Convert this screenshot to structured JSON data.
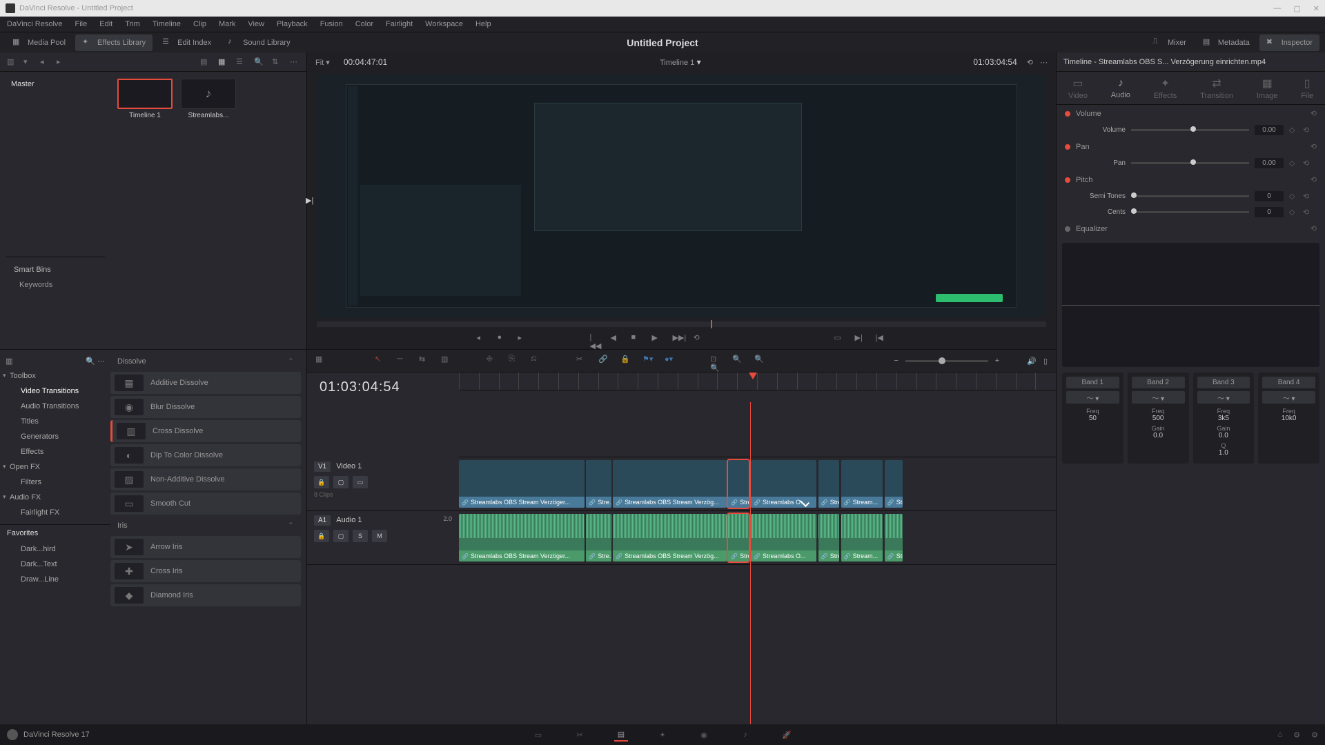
{
  "titlebar": {
    "text": "DaVinci Resolve - Untitled Project"
  },
  "menu": [
    "DaVinci Resolve",
    "File",
    "Edit",
    "Trim",
    "Timeline",
    "Clip",
    "Mark",
    "View",
    "Playback",
    "Fusion",
    "Color",
    "Fairlight",
    "Workspace",
    "Help"
  ],
  "shelf": {
    "media_pool": "Media Pool",
    "fx_lib": "Effects Library",
    "edit_index": "Edit Index",
    "sound_lib": "Sound Library",
    "mixer": "Mixer",
    "metadata": "Metadata",
    "inspector": "Inspector"
  },
  "project_title": "Untitled Project",
  "bins": {
    "master": "Master",
    "smart": "Smart Bins",
    "keywords": "Keywords"
  },
  "clips": [
    {
      "name": "Timeline 1",
      "sel": true
    },
    {
      "name": "Streamlabs...",
      "sel": false
    }
  ],
  "viewer": {
    "fit": "Fit",
    "left_tc": "00:04:47:01",
    "name": "Timeline 1",
    "right_tc": "01:03:04:54"
  },
  "fx_nav": {
    "toolbox": "Toolbox",
    "vt": "Video Transitions",
    "at": "Audio Transitions",
    "titles": "Titles",
    "gen": "Generators",
    "effects": "Effects",
    "ofx": "Open FX",
    "filters": "Filters",
    "afx": "Audio FX",
    "ffx": "Fairlight FX",
    "fav": "Favorites",
    "f1": "Dark...hird",
    "f2": "Dark...Text",
    "f3": "Draw...Line"
  },
  "fx_list": {
    "dissolve": "Dissolve",
    "d1": "Additive Dissolve",
    "d2": "Blur Dissolve",
    "d3": "Cross Dissolve",
    "d4": "Dip To Color Dissolve",
    "d5": "Non-Additive Dissolve",
    "d6": "Smooth Cut",
    "iris": "Iris",
    "i1": "Arrow Iris",
    "i2": "Cross Iris",
    "i3": "Diamond Iris"
  },
  "timeline": {
    "tc": "01:03:04:54",
    "v1": "V1",
    "v1n": "Video 1",
    "a1": "A1",
    "a1n": "Audio 1",
    "a1ch": "2.0",
    "eight": "8 Clips"
  },
  "tclips": [
    {
      "l": 0,
      "w": 21,
      "n": "Streamlabs OBS Stream Verzöger..."
    },
    {
      "l": 21.3,
      "w": 4.2,
      "n": "Stre..."
    },
    {
      "l": 25.8,
      "w": 19,
      "n": "Streamlabs OBS Stream Verzög..."
    },
    {
      "l": 45.1,
      "w": 3.5,
      "n": "Stre...",
      "sel": true
    },
    {
      "l": 48.9,
      "w": 11,
      "n": "Streamlabs O..."
    },
    {
      "l": 60.2,
      "w": 3.5,
      "n": "Stre..."
    },
    {
      "l": 64,
      "w": 7,
      "n": "Stream..."
    },
    {
      "l": 71.3,
      "w": 3,
      "n": "Stre..."
    }
  ],
  "insp": {
    "title": "Timeline - Streamlabs OBS S... Verzögerung einrichten.mp4",
    "tabs": {
      "video": "Video",
      "audio": "Audio",
      "effects": "Effects",
      "transition": "Transition",
      "image": "Image",
      "file": "File"
    },
    "volume": "Volume",
    "volume_lbl": "Volume",
    "volume_val": "0.00",
    "pan": "Pan",
    "pan_lbl": "Pan",
    "pan_val": "0.00",
    "pitch": "Pitch",
    "semi": "Semi Tones",
    "semi_val": "0",
    "cents": "Cents",
    "cents_val": "0",
    "eq": "Equalizer",
    "bands": [
      {
        "n": "Band 1",
        "freq_l": "Freq",
        "freq": "50",
        "gain_l": "",
        "gain": ""
      },
      {
        "n": "Band 2",
        "freq_l": "Freq",
        "freq": "500",
        "gain_l": "Gain",
        "gain": "0.0"
      },
      {
        "n": "Band 3",
        "freq_l": "Freq",
        "freq": "3k5",
        "gain_l": "Gain",
        "gain": "0.0",
        "q_l": "Q",
        "q": "1.0"
      },
      {
        "n": "Band 4",
        "freq_l": "Freq",
        "freq": "10k0",
        "gain_l": "",
        "gain": ""
      }
    ]
  },
  "footer": {
    "ver": "DaVinci Resolve 17"
  }
}
